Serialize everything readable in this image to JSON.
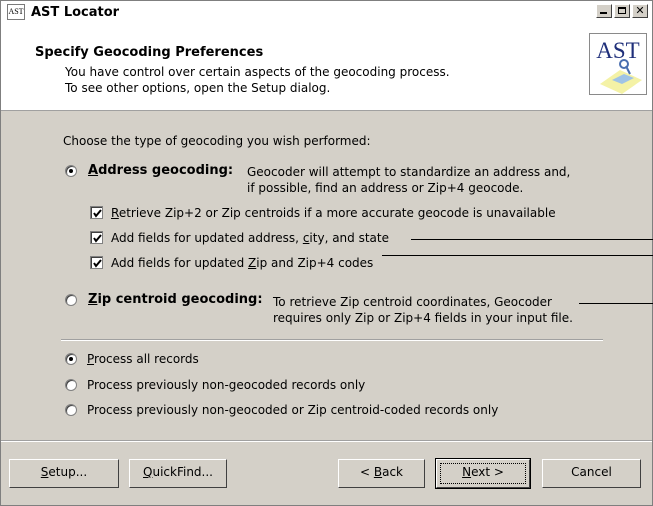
{
  "window": {
    "title": "AST Locator",
    "icon_text": "AST",
    "minimize_label": "_",
    "maximize_label": "□",
    "close_label": "✕"
  },
  "header": {
    "title": "Specify Geocoding Preferences",
    "desc_line1": "You have control over certain aspects of the geocoding process.",
    "desc_line2": "To see other options, open the Setup dialog.",
    "logo_text": "AST"
  },
  "main": {
    "prompt": "Choose the type of geocoding you wish performed:",
    "address_geocoding": {
      "label_first": "A",
      "label_rest": "ddress geocoding:",
      "desc_line1": "Geocoder will attempt to standardize an address and,",
      "desc_line2": "if possible, find an address or Zip+4 geocode.",
      "selected": true
    },
    "options": [
      {
        "pre": "",
        "mnemonic": "R",
        "post": "etrieve Zip+2 or Zip centroids if a more accurate geocode is unavailable",
        "checked": true
      },
      {
        "pre": "Add fields for updated address, ",
        "mnemonic": "c",
        "post": "ity, and state",
        "checked": true
      },
      {
        "pre": "Add fields for updated ",
        "mnemonic": "Z",
        "post": "ip and Zip+4 codes",
        "checked": true
      }
    ],
    "zip_geocoding": {
      "label_first": "Z",
      "label_rest": "ip centroid geocoding:",
      "desc_line1": "To retrieve Zip centroid coordinates, Geocoder",
      "desc_line2": "requires only Zip or Zip+4 fields in your input file.",
      "selected": false
    },
    "records": [
      {
        "pre": "",
        "mnemonic": "P",
        "post": "rocess all records",
        "selected": true
      },
      {
        "pre": "Process previously non-geocoded records only",
        "mnemonic": "",
        "post": "",
        "selected": false
      },
      {
        "pre": "Process previously non-geocoded or Zip centroid-coded records only",
        "mnemonic": "",
        "post": "",
        "selected": false
      }
    ]
  },
  "buttons": {
    "setup": {
      "mnemonic": "S",
      "rest": "etup..."
    },
    "quickfind": {
      "mnemonic": "Q",
      "rest": "uickFind..."
    },
    "back": {
      "pre": "< ",
      "mnemonic": "B",
      "rest": "ack"
    },
    "next": {
      "mnemonic": "N",
      "rest": "ext >"
    },
    "cancel": {
      "label": "Cancel"
    }
  }
}
